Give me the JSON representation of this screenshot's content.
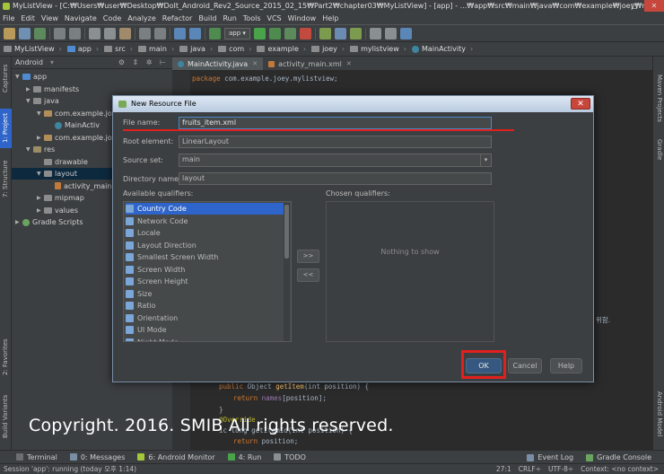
{
  "window": {
    "title": "MyListView - [C:₩Users₩user₩Desktop₩DoIt_Android_Rev2_Source_2015_02_15₩Part2₩chapter03₩MyListView] - [app] - ...₩app₩src₩main₩java₩com₩example₩joey₩mylistview₩Main...",
    "minimize": "–",
    "maximize": "□",
    "close": "✕"
  },
  "menu": [
    "File",
    "Edit",
    "View",
    "Navigate",
    "Code",
    "Analyze",
    "Refactor",
    "Build",
    "Run",
    "Tools",
    "VCS",
    "Window",
    "Help"
  ],
  "toolbar": {
    "run_config": "app ▾"
  },
  "breadcrumbs": [
    "MyListView",
    "app",
    "src",
    "main",
    "java",
    "com",
    "example",
    "joey",
    "mylistview",
    "MainActivity"
  ],
  "left_tabs": [
    "Captures",
    "1: Project",
    "7: Structure",
    "2: Favorites",
    "Build Variants"
  ],
  "right_tabs": [
    "Maven Projects",
    "Gradle",
    "Android Model"
  ],
  "project": {
    "view_selector": "Android",
    "toolbar_icons": "⚙ ⇕ ✲ ⊢",
    "tree": [
      {
        "label": "app",
        "indent": 0,
        "icon": "blue",
        "open": true
      },
      {
        "label": "manifests",
        "indent": 1,
        "icon": "gray",
        "open": false
      },
      {
        "label": "java",
        "indent": 1,
        "icon": "gray",
        "open": true
      },
      {
        "label": "com.example.joey",
        "indent": 2,
        "icon": "pkg",
        "open": true
      },
      {
        "label": "MainActiv",
        "indent": 3,
        "icon": "cls",
        "open": null
      },
      {
        "label": "com.example.joey",
        "indent": 2,
        "icon": "pkg",
        "open": false
      },
      {
        "label": "res",
        "indent": 1,
        "icon": "res",
        "open": true
      },
      {
        "label": "drawable",
        "indent": 2,
        "icon": "gray",
        "open": null
      },
      {
        "label": "layout",
        "indent": 2,
        "icon": "gray",
        "open": true,
        "selected": true
      },
      {
        "label": "activity_main",
        "indent": 3,
        "icon": "xml",
        "open": null
      },
      {
        "label": "mipmap",
        "indent": 2,
        "icon": "gray",
        "open": false
      },
      {
        "label": "values",
        "indent": 2,
        "icon": "gray",
        "open": false
      },
      {
        "label": "Gradle Scripts",
        "indent": 0,
        "icon": "grad",
        "open": false
      }
    ]
  },
  "editor": {
    "tabs": [
      {
        "label": "MainActivity.java",
        "type": "java",
        "active": true
      },
      {
        "label": "activity_main.xml",
        "type": "xml",
        "active": false
      }
    ],
    "code": {
      "line1_kw": "package",
      "line1_rest": " com.example.joey.mylistview;",
      "right_fragment": "위함.",
      "l_public": "public",
      "l_object": " Object ",
      "l_getitem": "getItem",
      "l_int": "(int position) {",
      "l_return": "return",
      "l_names": " names",
      "l_idx": "[position];",
      "l_brace": "}",
      "l_override": "@Override",
      "l_getid": "ic long getItemId(int position) {",
      "l_return2": "return",
      "l_pos": " position;"
    }
  },
  "dialog": {
    "title": "New Resource File",
    "close": "✕",
    "file_name_label": "File name:",
    "file_name_value": "fruits_item.xml",
    "root_element_label": "Root element:",
    "root_element_value": "LinearLayout",
    "source_set_label": "Source set:",
    "source_set_value": "main",
    "directory_name_label": "Directory name:",
    "directory_name_value": "layout",
    "available_label": "Available qualifiers:",
    "chosen_label": "Chosen qualifiers:",
    "available_qualifiers": [
      "Country Code",
      "Network Code",
      "Locale",
      "Layout Direction",
      "Smallest Screen Width",
      "Screen Width",
      "Screen Height",
      "Size",
      "Ratio",
      "Orientation",
      "UI Mode",
      "Night Mode"
    ],
    "add_button": ">>",
    "remove_button": "<<",
    "chosen_empty": "Nothing to show",
    "ok": "OK",
    "cancel": "Cancel",
    "help": "Help"
  },
  "watermark": "Copyright. 2016. SMIB All rights reserved.",
  "bottom_tabs": [
    "Terminal",
    "0: Messages",
    "6: Android Monitor",
    "4: Run",
    "TODO"
  ],
  "bottom_right": [
    "Event Log",
    "Gradle Console"
  ],
  "status": {
    "message": "Session 'app': running (today 오후 1:14)",
    "position": "27:1",
    "line_sep": "CRLF÷",
    "encoding": "UTF-8÷",
    "context": "Context: <no context>"
  }
}
